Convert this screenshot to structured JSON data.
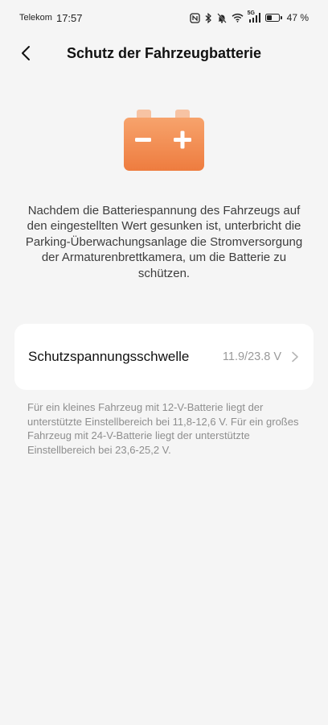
{
  "status_bar": {
    "carrier": "Telekom",
    "time": "17:57",
    "network": "5G",
    "battery_percent_text": "47 %",
    "battery_level": 0.47
  },
  "header": {
    "title": "Schutz der Fahrzeugbatterie"
  },
  "hero": {
    "icon": "car-battery-icon",
    "color_top": "#f7a36c",
    "color_bottom": "#ee7c3f"
  },
  "description": "Nachdem die Batteriespannung des Fahrzeugs auf den eingestellten Wert gesunken ist, unterbricht die Parking-Überwachungsanlage die Stromversorgung der Armaturenbrettkamera, um die Batterie zu schützen.",
  "setting": {
    "label": "Schutzspannungsschwelle",
    "value": "11.9/23.8 V"
  },
  "hint": "Für ein kleines Fahrzeug mit 12-V-Batterie liegt der unterstützte Einstellbereich bei 11,8-12,6 V. Für ein großes Fahrzeug mit 24-V-Batterie liegt der unterstützte Einstellbereich bei 23,6-25,2 V."
}
